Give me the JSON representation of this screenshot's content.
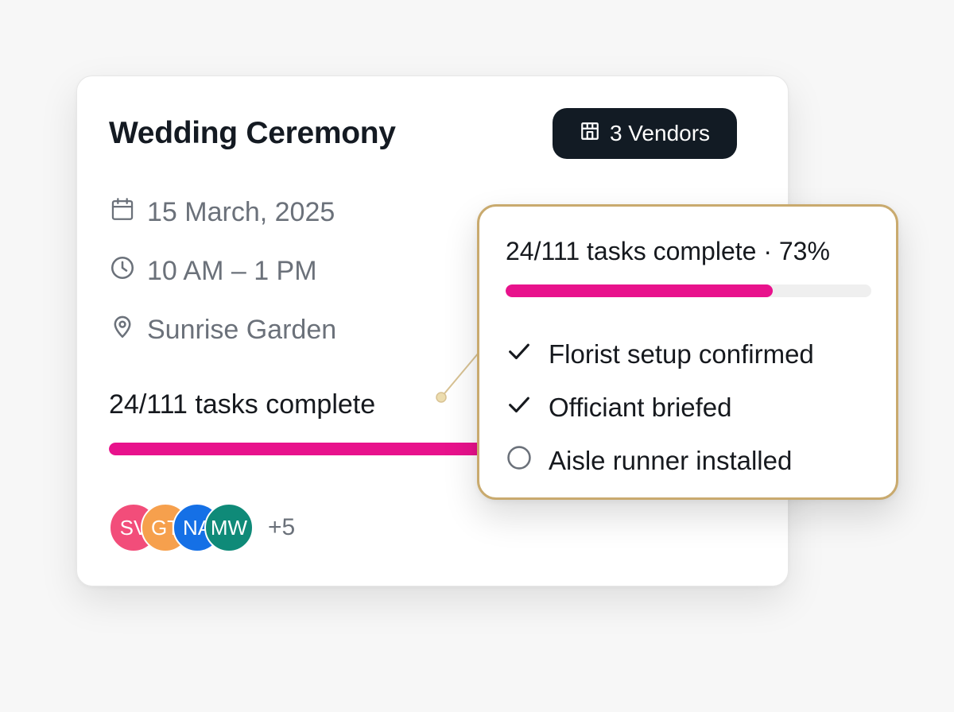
{
  "event": {
    "title": "Wedding Ceremony",
    "vendors_label": "3 Vendors",
    "date": "15 March, 2025",
    "time": "10 AM – 1 PM",
    "location": "Sunrise Garden",
    "tasks_label": "24/111 tasks complete",
    "progress": 0.73,
    "avatars": [
      {
        "initials": "SV",
        "color": "#f24d7a"
      },
      {
        "initials": "GT",
        "color": "#f6a04d"
      },
      {
        "initials": "NA",
        "color": "#1570e6"
      },
      {
        "initials": "MW",
        "color": "#0f8a78"
      }
    ],
    "more_count": "+5"
  },
  "tooltip": {
    "summary": "24/111 tasks complete · 73%",
    "progress": 0.73,
    "items": [
      {
        "label": "Florist setup confirmed",
        "done": true
      },
      {
        "label": "Officiant briefed",
        "done": true
      },
      {
        "label": "Aisle runner installed",
        "done": false
      }
    ]
  },
  "colors": {
    "accent": "#e8128c",
    "badge": "#121b24",
    "tooltip_border": "#c9aa6e"
  },
  "icons": {
    "vendors": "storefront-icon",
    "date": "calendar-icon",
    "time": "clock-icon",
    "location": "map-pin-icon",
    "done": "checkmark-icon",
    "pending": "empty-circle-icon"
  }
}
